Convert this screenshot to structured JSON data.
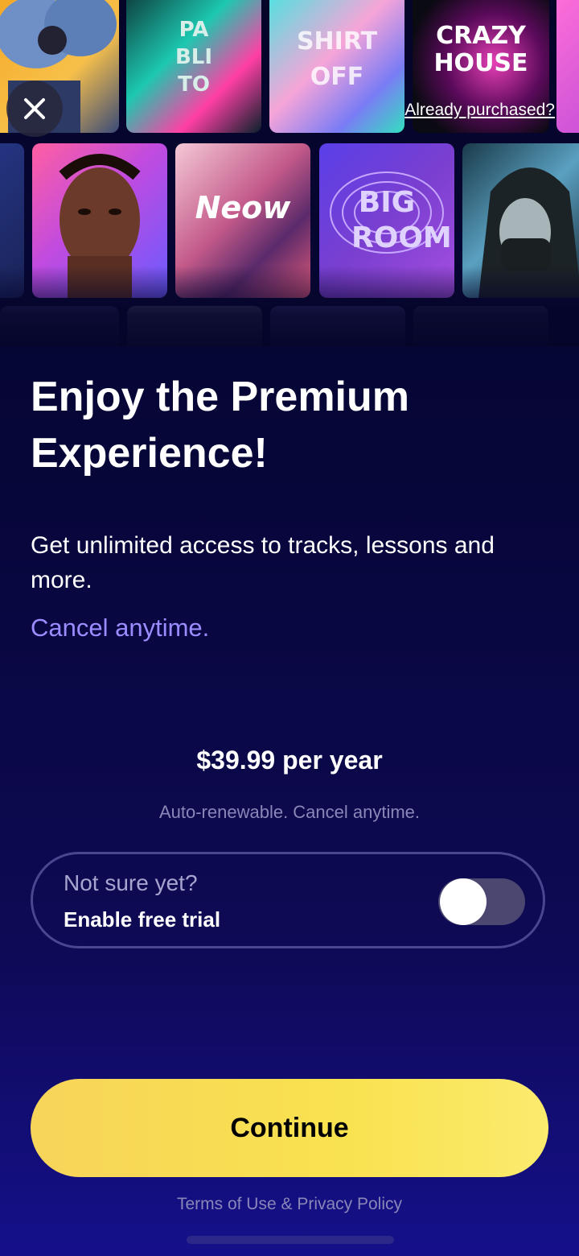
{
  "header": {
    "close_icon": "close-icon",
    "already_purchased": "Already purchased?"
  },
  "covers": [
    {
      "name": "bow-portrait",
      "label": ""
    },
    {
      "name": "pablito",
      "label": "PA BLI TO"
    },
    {
      "name": "shirt-off",
      "label": "SHIRT OFF"
    },
    {
      "name": "crazy-house",
      "label": "CRAZY HOUSE"
    },
    {
      "name": "portrait-man",
      "label": ""
    },
    {
      "name": "neow",
      "label": "Neow"
    },
    {
      "name": "big-room",
      "label": "BIG ROOM"
    },
    {
      "name": "hooded-figure",
      "label": ""
    }
  ],
  "content": {
    "headline": "Enjoy the Premium Experience!",
    "subtext": "Get unlimited access to tracks, lessons and more.",
    "cancel_text": "Cancel anytime."
  },
  "pricing": {
    "price": "$39.99 per year",
    "renewal_note": "Auto-renewable. Cancel anytime."
  },
  "trial": {
    "question": "Not sure yet?",
    "label": "Enable free trial",
    "enabled": false
  },
  "cta": {
    "continue_label": "Continue"
  },
  "footer": {
    "legal": "Terms of Use & Privacy Policy"
  },
  "colors": {
    "background": "#07063a",
    "accent": "#9b8cff",
    "cta": "#f9e24f"
  }
}
